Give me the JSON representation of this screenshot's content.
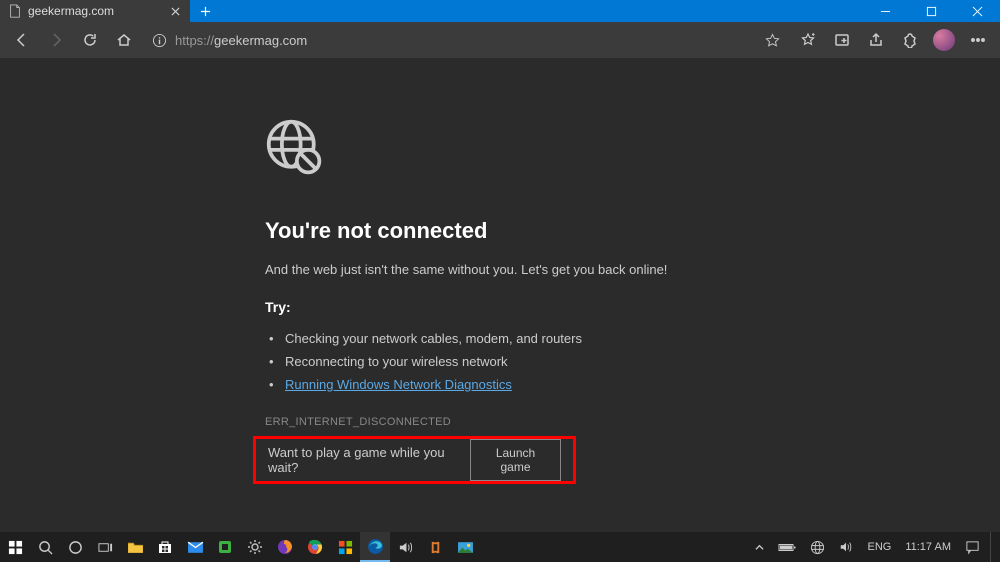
{
  "tab": {
    "title": "geekermag.com"
  },
  "toolbar": {
    "url_proto": "https://",
    "url_host": "geekermag.com"
  },
  "error": {
    "heading": "You're not connected",
    "subtitle": "And the web just isn't the same without you. Let's get you back online!",
    "try_header": "Try:",
    "bullets": [
      "Checking your network cables, modem, and routers",
      "Reconnecting to your wireless network"
    ],
    "diag_link": "Running Windows Network Diagnostics",
    "code": "ERR_INTERNET_DISCONNECTED"
  },
  "game": {
    "prompt": "Want to play a game while you wait?",
    "button": "Launch game"
  },
  "systray": {
    "lang": "ENG",
    "time": "11:17 AM"
  }
}
